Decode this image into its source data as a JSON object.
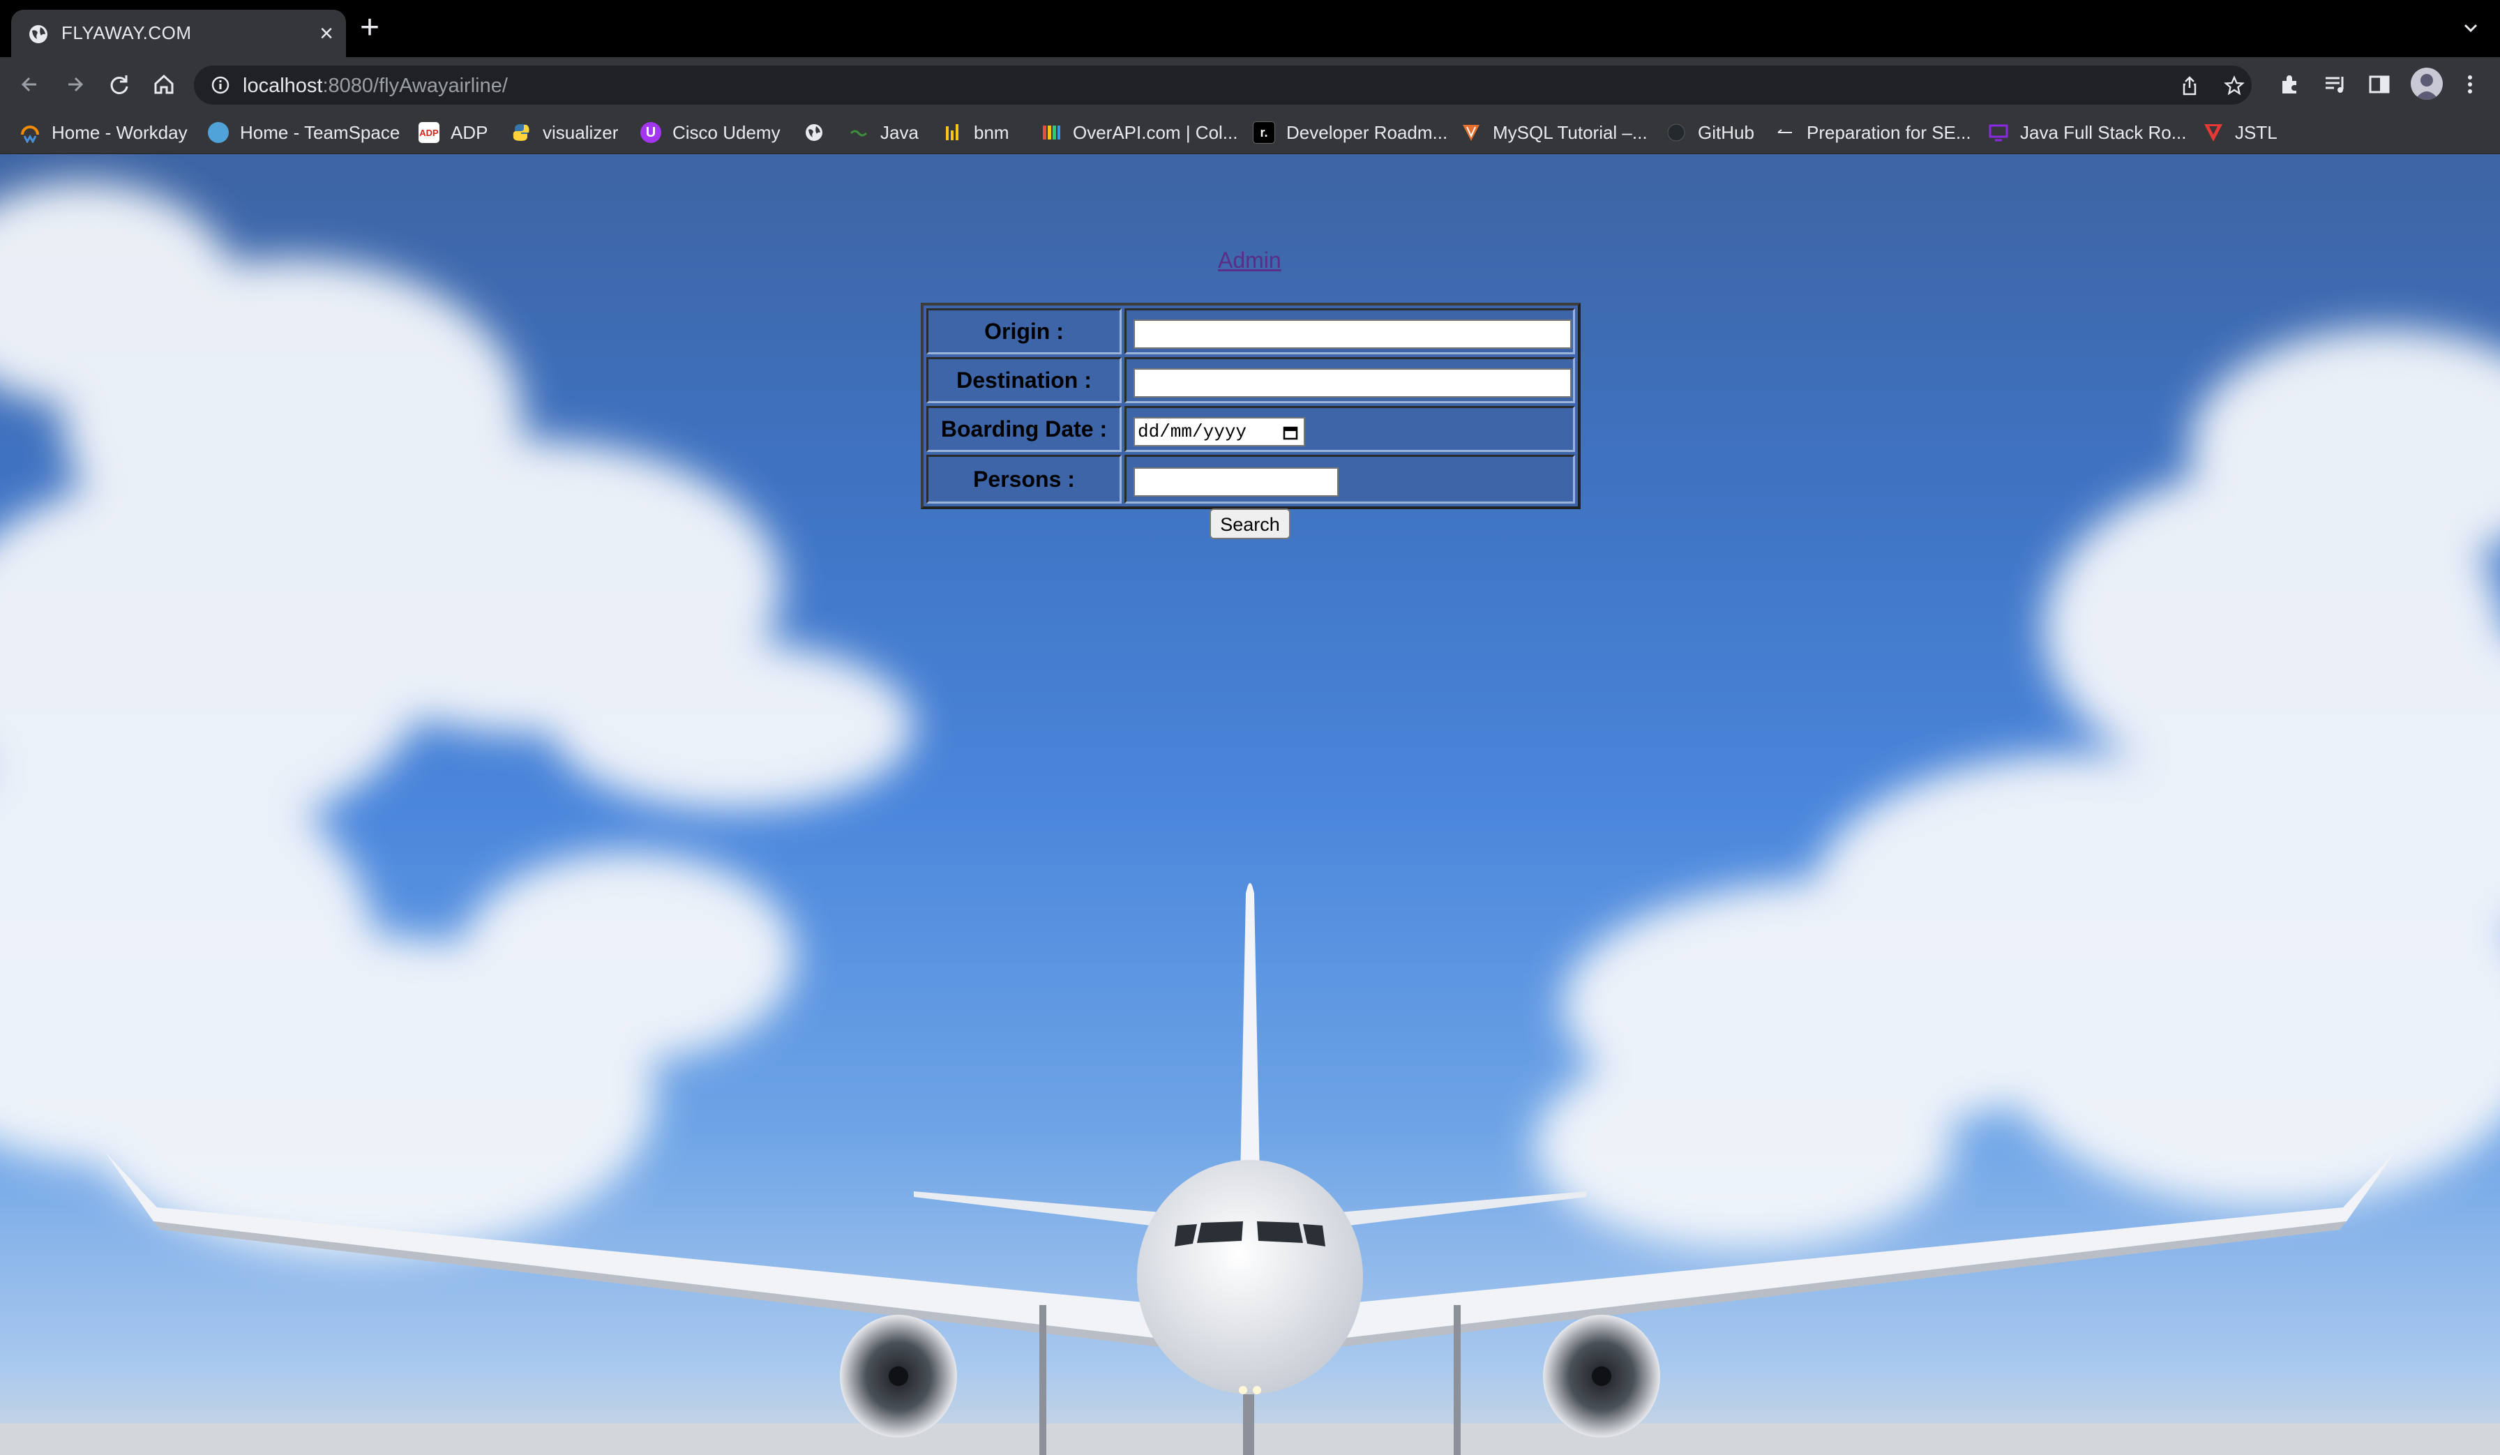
{
  "browser": {
    "tab": {
      "title": "FLYAWAY.COM",
      "close": "×"
    },
    "new_tab": "+",
    "url": {
      "host": "localhost",
      "path": ":8080/flyAwayairline/"
    },
    "bookmarks": [
      {
        "label": "Home - Workday",
        "icon": "workday-icon",
        "color": "#f38b00"
      },
      {
        "label": "Home - TeamSpace",
        "icon": "teamspace-icon",
        "color": "#4fa3d8"
      },
      {
        "label": "ADP",
        "icon": "adp-icon",
        "color": "#d0271d"
      },
      {
        "label": "visualizer",
        "icon": "python-icon",
        "color": "#3776ab"
      },
      {
        "label": "Cisco Udemy",
        "icon": "udemy-icon",
        "color": "#a435f0"
      },
      {
        "label": "",
        "icon": "globe-icon",
        "color": "#e8eaed"
      },
      {
        "label": "Java",
        "icon": "java-icon",
        "color": "#3c8d3c"
      },
      {
        "label": "bnm",
        "icon": "bnm-icon",
        "color": "#f5c518"
      },
      {
        "label": "OverAPI.com | Col...",
        "icon": "overapi-icon",
        "color": "#7a7a7a"
      },
      {
        "label": "Developer Roadm...",
        "icon": "roadmap-icon",
        "color": "#000000"
      },
      {
        "label": "MySQL Tutorial –...",
        "icon": "mysql-icon",
        "color": "#e76f2e"
      },
      {
        "label": "GitHub",
        "icon": "github-icon",
        "color": "#24292e"
      },
      {
        "label": "Preparation for SE...",
        "icon": "prep-icon",
        "color": "#e8eaed"
      },
      {
        "label": "Java Full Stack Ro...",
        "icon": "monitor-icon",
        "color": "#8a2be2"
      },
      {
        "label": "JSTL",
        "icon": "vuetify-icon",
        "color": "#e53935"
      }
    ]
  },
  "page": {
    "admin_link": "Admin",
    "form": {
      "origin_label": "Origin :",
      "origin_value": "",
      "destination_label": "Destination :",
      "destination_value": "",
      "boarding_date_label": "Boarding Date :",
      "boarding_date_placeholder": "dd/mm/yyyy",
      "persons_label": "Persons :",
      "persons_value": "",
      "search_button": "Search"
    }
  }
}
